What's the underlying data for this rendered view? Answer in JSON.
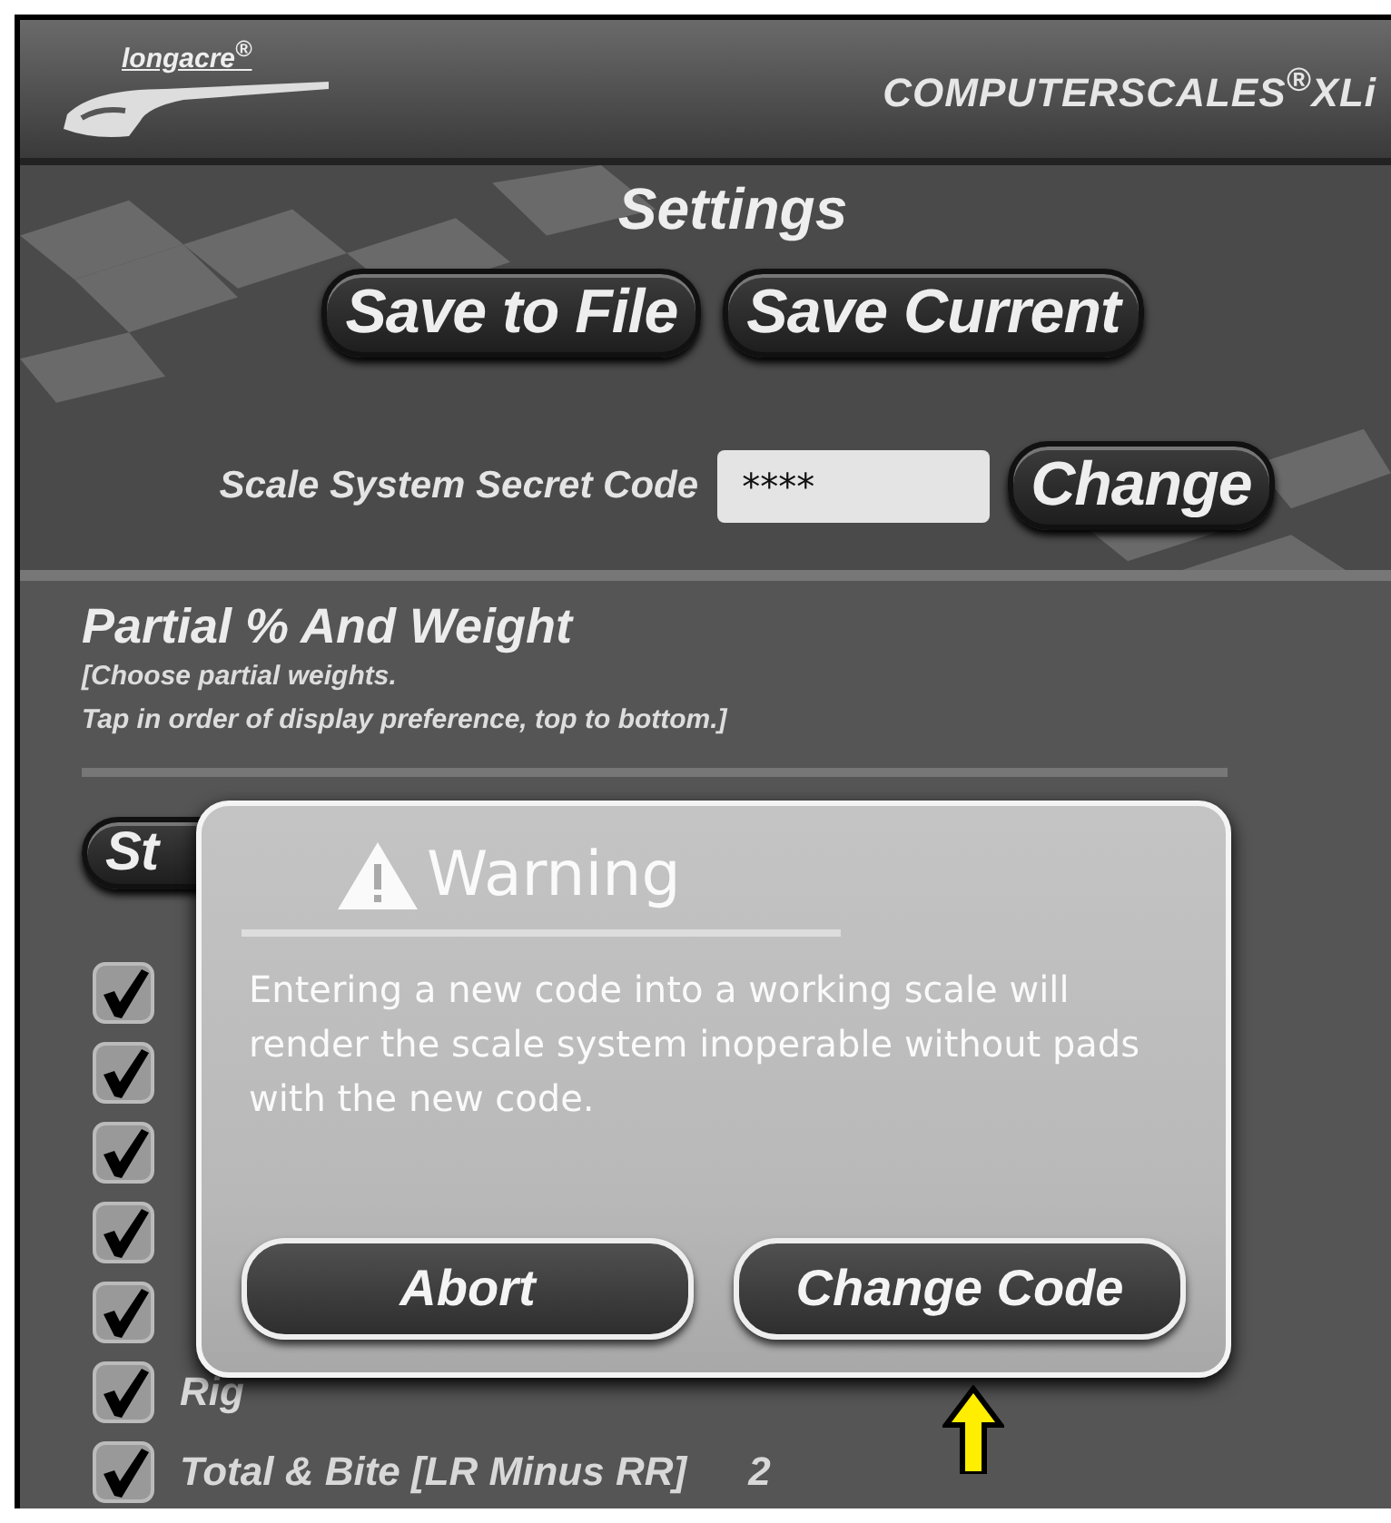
{
  "header": {
    "logo": "longacre$^{®}$",
    "product": "COMPUTERSCALES$^{®}$XLi"
  },
  "title": "Settings",
  "file_buttons": [
    "Save to File",
    "Save Current"
  ],
  "secret_code": {
    "label": "Scale System Secret Code",
    "value": "****",
    "button": "Change"
  },
  "partial": {
    "title": "Partial % And Weight",
    "hint": [
      "[Choose partial weights.",
      "Tap in order of display preference, top to bottom.]"
    ],
    "button": "St",
    "rows": [
      {
        "checked": true
      },
      {
        "checked": true
      },
      {
        "checked": true
      },
      {
        "checked": true
      },
      {
        "checked": true
      },
      {
        "checked": true,
        "label": "Rig"
      },
      {
        "checked": true,
        "label": "Total & Bite [LR Minus RR]",
        "value": "2"
      }
    ]
  },
  "dialog": {
    "title": "Warning",
    "message": "Entering a new code into a working scale will render the scale system inoperable without pads with the new code.",
    "buttons": [
      "Abort",
      "Change Code"
    ]
  }
}
